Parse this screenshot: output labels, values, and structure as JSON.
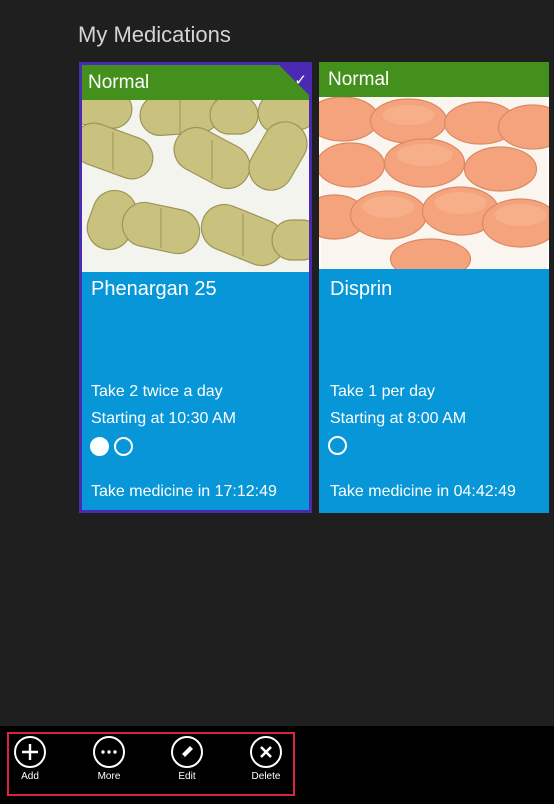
{
  "page": {
    "title": "My Medications"
  },
  "medications": [
    {
      "status": "Normal",
      "selected": true,
      "name": "Phenargan 25",
      "dosage": "Take 2 twice a day",
      "start": "Starting at 10:30 AM",
      "doses_total": 2,
      "doses_taken": 1,
      "countdown": "Take medicine in 17:12:49",
      "image": "yellow-tablets"
    },
    {
      "status": "Normal",
      "selected": false,
      "name": "Disprin",
      "dosage": "Take 1 per day",
      "start": "Starting at 8:00 AM",
      "doses_total": 1,
      "doses_taken": 0,
      "countdown": "Take medicine in 04:42:49",
      "image": "peach-tablets"
    }
  ],
  "app_bar": {
    "commands": [
      {
        "label": "Add",
        "icon": "add-icon"
      },
      {
        "label": "More",
        "icon": "more-icon"
      },
      {
        "label": "Edit",
        "icon": "edit-icon"
      },
      {
        "label": "Delete",
        "icon": "delete-icon"
      }
    ]
  },
  "colors": {
    "background": "#1f1f1f",
    "tile": "#0797d8",
    "status_normal": "#43911c",
    "selection": "#4a2ab3",
    "highlight_frame": "#d8253f"
  }
}
